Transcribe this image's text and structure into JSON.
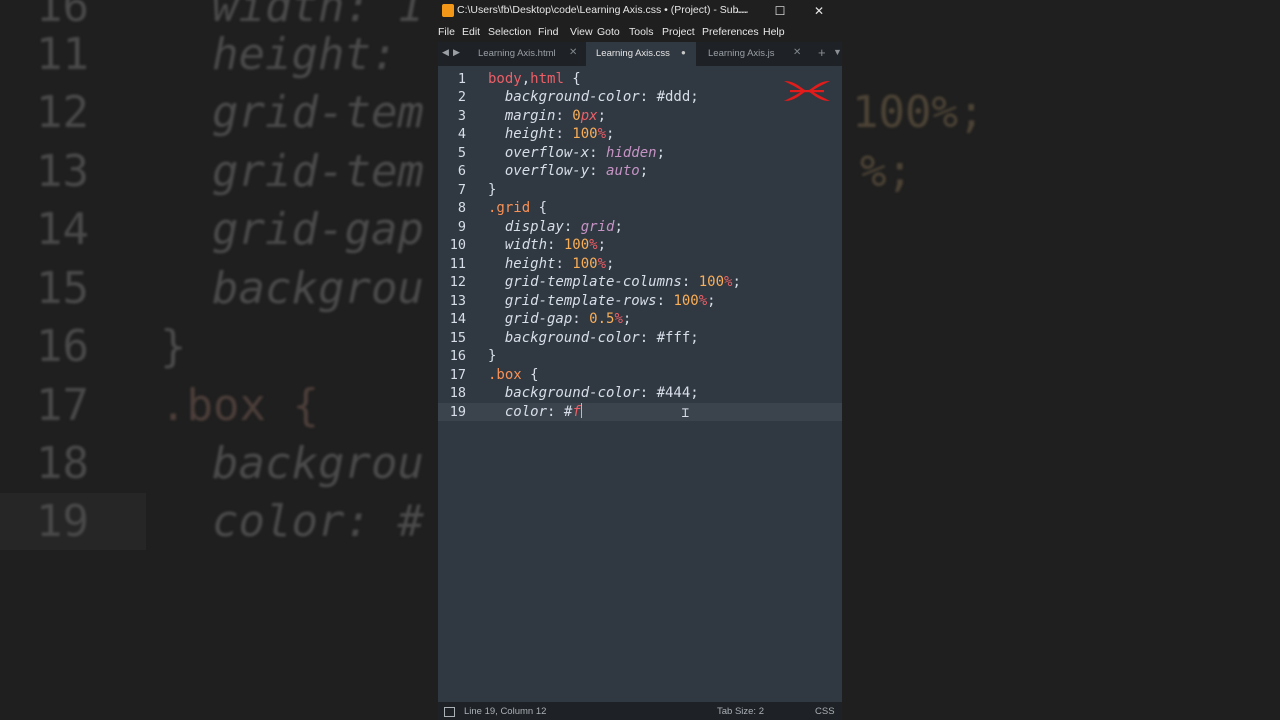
{
  "background": {
    "lines": [
      {
        "num": "16",
        "code": "width: 1"
      },
      {
        "num": "11",
        "code": "height: "
      },
      {
        "num": "12",
        "code": "grid-tem"
      },
      {
        "num": "13",
        "code": "grid-tem"
      },
      {
        "num": "14",
        "code": "grid-gap"
      },
      {
        "num": "15",
        "code": "backgrou"
      },
      {
        "num": "16",
        "code": "}"
      },
      {
        "num": "17",
        "code": ".box {"
      },
      {
        "num": "18",
        "code": "backgrou"
      },
      {
        "num": "19",
        "code": "color: #"
      }
    ],
    "right_fragments": [
      "100%;",
      "%;"
    ]
  },
  "window": {
    "title": "C:\\Users\\fb\\Desktop\\code\\Learning Axis.css • (Project) - Sub...",
    "minimize": "—",
    "maximize": "☐",
    "close": "✕"
  },
  "menu": [
    "File",
    "Edit",
    "Selection",
    "Find",
    "View",
    "Goto",
    "Tools",
    "Project",
    "Preferences",
    "Help"
  ],
  "tabs": [
    {
      "label": "Learning Axis.html",
      "close": "✕",
      "active": false
    },
    {
      "label": "Learning Axis.css",
      "close": "●",
      "active": true
    },
    {
      "label": "Learning Axis.js",
      "close": "✕",
      "active": false
    }
  ],
  "tab_controls": {
    "left": "◀",
    "right": "▶",
    "plus": "+",
    "dropdown": "▼"
  },
  "code_lines": [
    {
      "n": "1",
      "segments": [
        [
          "sel",
          "body"
        ],
        [
          "brace",
          ","
        ],
        [
          "sel",
          "html"
        ],
        [
          "brace",
          " {"
        ]
      ]
    },
    {
      "n": "2",
      "segments": [
        [
          "brace",
          "  "
        ],
        [
          "prop",
          "background-color"
        ],
        [
          "brace",
          ": "
        ],
        [
          "hex",
          "#ddd"
        ],
        [
          "brace",
          ";"
        ]
      ]
    },
    {
      "n": "3",
      "segments": [
        [
          "brace",
          "  "
        ],
        [
          "prop",
          "margin"
        ],
        [
          "brace",
          ": "
        ],
        [
          "num",
          "0"
        ],
        [
          "unit",
          "px"
        ],
        [
          "brace",
          ";"
        ]
      ]
    },
    {
      "n": "4",
      "segments": [
        [
          "brace",
          "  "
        ],
        [
          "prop",
          "height"
        ],
        [
          "brace",
          ": "
        ],
        [
          "num",
          "100"
        ],
        [
          "pct",
          "%"
        ],
        [
          "brace",
          ";"
        ]
      ]
    },
    {
      "n": "5",
      "segments": [
        [
          "brace",
          "  "
        ],
        [
          "prop",
          "overflow-x"
        ],
        [
          "brace",
          ": "
        ],
        [
          "kw",
          "hidden"
        ],
        [
          "brace",
          ";"
        ]
      ]
    },
    {
      "n": "6",
      "segments": [
        [
          "brace",
          "  "
        ],
        [
          "prop",
          "overflow-y"
        ],
        [
          "brace",
          ": "
        ],
        [
          "kw",
          "auto"
        ],
        [
          "brace",
          ";"
        ]
      ]
    },
    {
      "n": "7",
      "segments": [
        [
          "brace",
          "}"
        ]
      ]
    },
    {
      "n": "8",
      "segments": [
        [
          "cls",
          ".grid"
        ],
        [
          "brace",
          " {"
        ]
      ]
    },
    {
      "n": "9",
      "segments": [
        [
          "brace",
          "  "
        ],
        [
          "prop",
          "display"
        ],
        [
          "brace",
          ": "
        ],
        [
          "kw",
          "grid"
        ],
        [
          "brace",
          ";"
        ]
      ]
    },
    {
      "n": "10",
      "segments": [
        [
          "brace",
          "  "
        ],
        [
          "prop",
          "width"
        ],
        [
          "brace",
          ": "
        ],
        [
          "num",
          "100"
        ],
        [
          "pct",
          "%"
        ],
        [
          "brace",
          ";"
        ]
      ]
    },
    {
      "n": "11",
      "segments": [
        [
          "brace",
          "  "
        ],
        [
          "prop",
          "height"
        ],
        [
          "brace",
          ": "
        ],
        [
          "num",
          "100"
        ],
        [
          "pct",
          "%"
        ],
        [
          "brace",
          ";"
        ]
      ]
    },
    {
      "n": "12",
      "segments": [
        [
          "brace",
          "  "
        ],
        [
          "prop",
          "grid-template-columns"
        ],
        [
          "brace",
          ": "
        ],
        [
          "num",
          "100"
        ],
        [
          "pct",
          "%"
        ],
        [
          "brace",
          ";"
        ]
      ]
    },
    {
      "n": "13",
      "segments": [
        [
          "brace",
          "  "
        ],
        [
          "prop",
          "grid-template-rows"
        ],
        [
          "brace",
          ": "
        ],
        [
          "num",
          "100"
        ],
        [
          "pct",
          "%"
        ],
        [
          "brace",
          ";"
        ]
      ]
    },
    {
      "n": "14",
      "segments": [
        [
          "brace",
          "  "
        ],
        [
          "prop",
          "grid-gap"
        ],
        [
          "brace",
          ": "
        ],
        [
          "num",
          "0.5"
        ],
        [
          "pct",
          "%"
        ],
        [
          "brace",
          ";"
        ]
      ]
    },
    {
      "n": "15",
      "segments": [
        [
          "brace",
          "  "
        ],
        [
          "prop",
          "background-color"
        ],
        [
          "brace",
          ": "
        ],
        [
          "hex",
          "#fff"
        ],
        [
          "brace",
          ";"
        ]
      ]
    },
    {
      "n": "16",
      "segments": [
        [
          "brace",
          "}"
        ]
      ]
    },
    {
      "n": "17",
      "segments": [
        [
          "cls",
          ".box"
        ],
        [
          "brace",
          " {"
        ]
      ]
    },
    {
      "n": "18",
      "segments": [
        [
          "brace",
          "  "
        ],
        [
          "prop",
          "background-color"
        ],
        [
          "brace",
          ": "
        ],
        [
          "hex",
          "#444"
        ],
        [
          "brace",
          ";"
        ]
      ]
    },
    {
      "n": "19",
      "segments": [
        [
          "brace",
          "  "
        ],
        [
          "prop",
          "color"
        ],
        [
          "brace",
          ": "
        ],
        [
          "hex",
          "#"
        ],
        [
          "unit",
          "f"
        ]
      ],
      "current": true
    }
  ],
  "status": {
    "position": "Line 19, Column 12",
    "tab_size": "Tab Size: 2",
    "syntax": "CSS"
  },
  "colors": {
    "editor_bg": "#303841",
    "chrome_bg": "#1f1f1f",
    "selector": "#ec5f67",
    "class": "#f99157",
    "keyword": "#c594c5",
    "number": "#f9ae58",
    "logo": "#e21b1b"
  }
}
